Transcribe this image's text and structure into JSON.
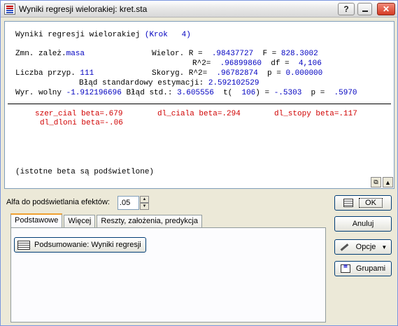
{
  "window": {
    "title": "Wyniki regresji wielorakiej: kret.sta"
  },
  "titlebar_buttons": {
    "help": "?"
  },
  "results": {
    "line1": {
      "label": "Wyniki regresji wielorakiej ",
      "step": "(Krok   4)"
    },
    "line2": {
      "label": "Zmn. zależ.",
      "dep": "masa",
      "r_label": "Wielor. R =  ",
      "r": ".98437727",
      "f_label": "  F = ",
      "f": "828.3002"
    },
    "line3": {
      "r2_label": "R^2=  ",
      "r2": ".96899860",
      "df_label": "  df =  ",
      "df": "4,106"
    },
    "line4": {
      "n_label": "Liczba przyp. ",
      "n": "111",
      "adj_label": "Skoryg. R^2=  ",
      "adj": ".96782874",
      "p_label": "  p = ",
      "p": "0.000000"
    },
    "line5": {
      "label": "Błąd standardowy estymacji: ",
      "value": "2.592102529"
    },
    "line6": {
      "intercept_label": "Wyr. wolny ",
      "intercept": "-1.912196696",
      "se_label": " Błąd std.: ",
      "se": "3.605556",
      "t_label": "  t(  ",
      "t_df": "106",
      "t_eq": ") = ",
      "t": "-.5303",
      "pv_label": "  p =  ",
      "pv": ".5970"
    },
    "betas": [
      "szer_cial beta=.679",
      "dl_ciala beta=.294",
      "dl_stopy beta=.117",
      "dl_dloni beta=-.06"
    ],
    "note": "(istotne beta są podświetlone)"
  },
  "alpha": {
    "label": "Alfa do podświetlania efektów:",
    "value": ".05"
  },
  "tabs": [
    {
      "label": "Podstawowe",
      "active": true
    },
    {
      "label": "Więcej",
      "active": false
    },
    {
      "label": "Reszty, założenia, predykcja",
      "active": false
    }
  ],
  "summary_button": "Podsumowanie:  Wyniki regresji",
  "side_buttons": {
    "ok": "OK",
    "anuluj": "Anuluj",
    "opcje": "Opcje",
    "grupami": "Grupami"
  },
  "colors": {
    "value_text": "#0000c0",
    "beta_highlight": "#d00000"
  }
}
